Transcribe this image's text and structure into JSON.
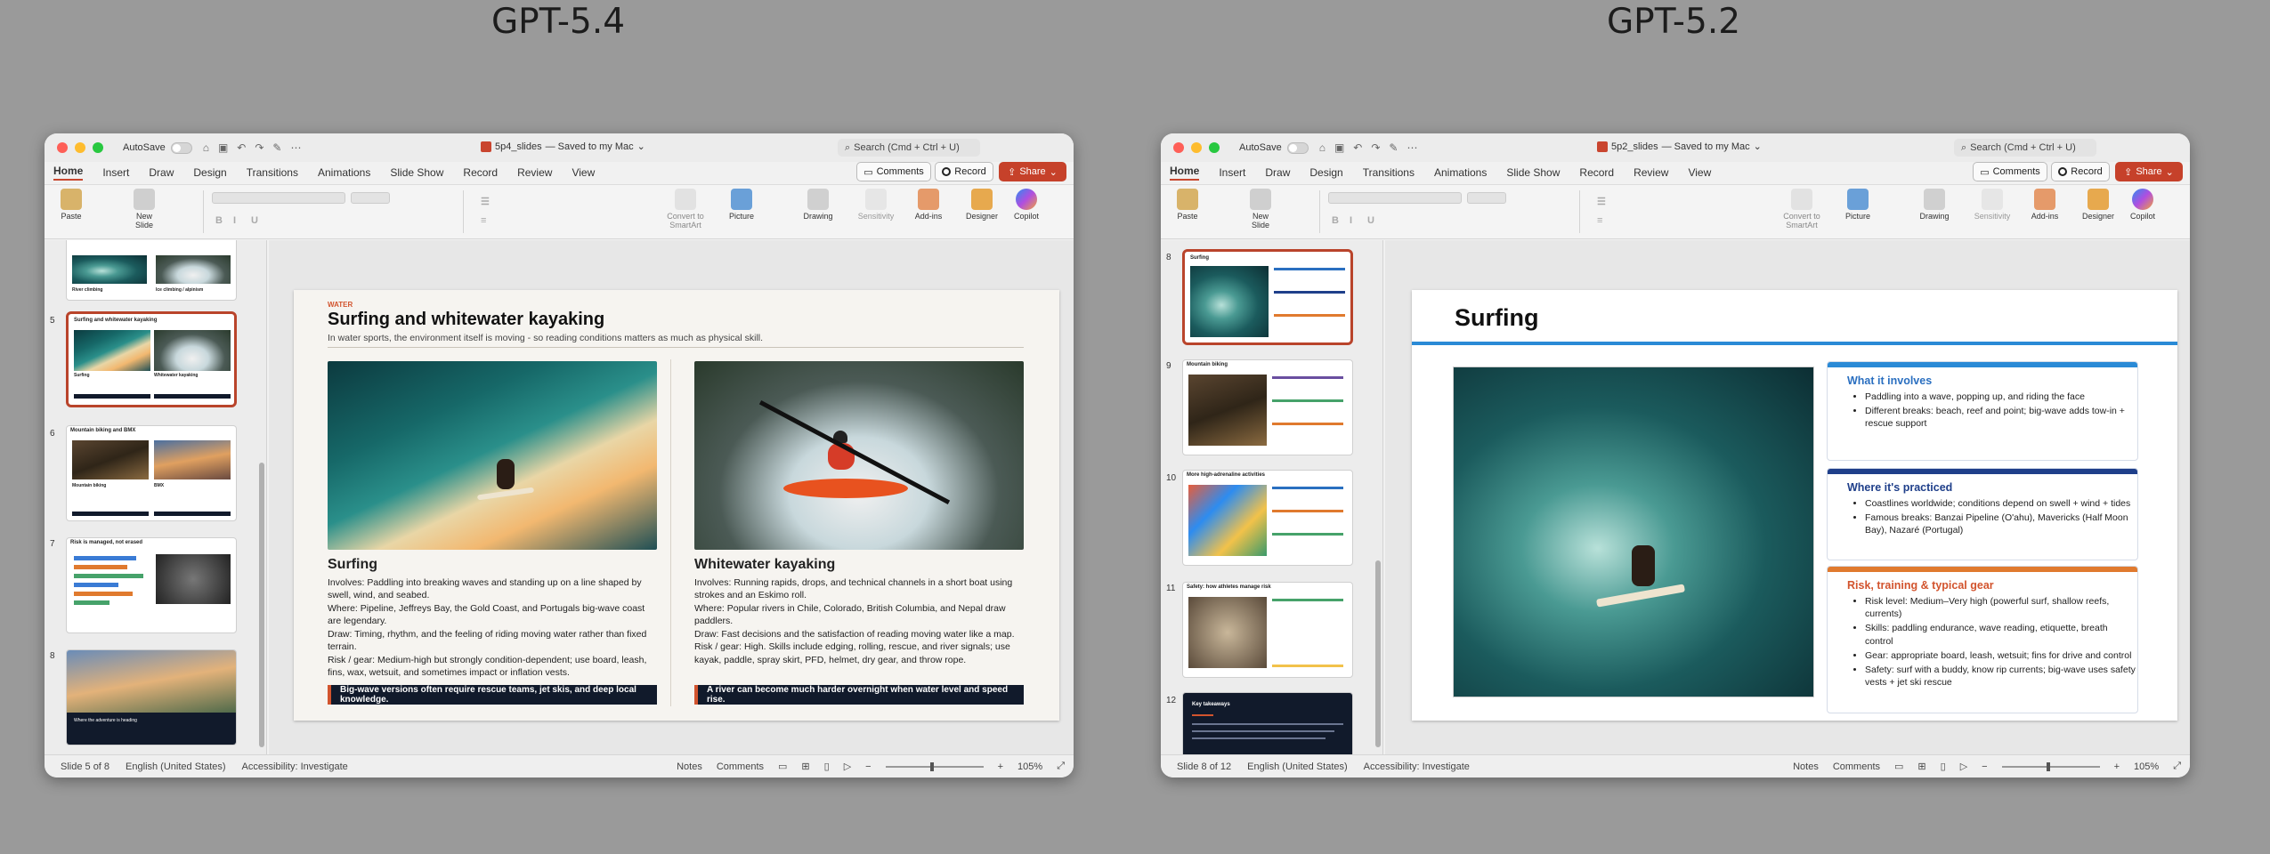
{
  "headings": {
    "left": "GPT-5.4",
    "right": "GPT-5.2"
  },
  "left_window": {
    "autosave_label": "AutoSave",
    "filename": "5p4_slides",
    "saved_status": "— Saved to my Mac",
    "search_placeholder": "Search (Cmd + Ctrl + U)",
    "menu": [
      "Home",
      "Insert",
      "Draw",
      "Design",
      "Transitions",
      "Animations",
      "Slide Show",
      "Record",
      "Review",
      "View"
    ],
    "comments_label": "Comments",
    "record_label": "Record",
    "share_label": "Share",
    "ribbon": {
      "paste": "Paste",
      "new_slide": "New Slide",
      "convert": "Convert to SmartArt",
      "picture": "Picture",
      "drawing": "Drawing",
      "sensitivity": "Sensitivity",
      "addins": "Add-ins",
      "designer": "Designer",
      "copilot": "Copilot"
    },
    "thumb_numbers": [
      "5",
      "6",
      "7",
      "8"
    ],
    "thumb_titles": {
      "t4a": "River climbing",
      "t4b": "Ice climbing / alpinism",
      "t5": "Surfing and whitewater kayaking",
      "t5a": "Surfing",
      "t5b": "Whitewater kayaking",
      "t6": "Mountain biking and BMX",
      "t6a": "Mountain biking",
      "t6b": "BMX",
      "t7": "Risk is managed, not erased",
      "t8": "Where the adventure is heading"
    },
    "slide": {
      "kicker": "WATER",
      "title": "Surfing and whitewater kayaking",
      "subtitle": "In water sports, the environment itself is moving - so reading conditions matters as much as physical skill.",
      "left_heading": "Surfing",
      "left_body": "Involves: Paddling into breaking waves and standing up on a line shaped by swell, wind, and seabed.\nWhere: Pipeline, Jeffreys Bay, the Gold Coast, and Portugals big-wave coast are legendary.\nDraw: Timing, rhythm, and the feeling of riding moving water rather than fixed terrain.\nRisk / gear: Medium-high but strongly condition-dependent; use board, leash, fins, wax, wetsuit, and sometimes impact or inflation vests.",
      "left_caption": "Big-wave versions often require rescue teams, jet skis, and deep local knowledge.",
      "right_heading": "Whitewater kayaking",
      "right_body": "Involves: Running rapids, drops, and technical channels in a short boat using strokes and an Eskimo roll.\nWhere: Popular rivers in Chile, Colorado, British Columbia, and Nepal draw paddlers.\nDraw: Fast decisions and the satisfaction of reading moving water like a map.\nRisk / gear: High. Skills include edging, rolling, rescue, and river signals; use kayak, paddle, spray skirt, PFD, helmet, dry gear, and throw rope.",
      "right_caption": "A river can become much harder overnight when water level and speed rise."
    },
    "status": {
      "slide": "Slide 5 of 8",
      "language": "English (United States)",
      "accessibility": "Accessibility: Investigate",
      "notes": "Notes",
      "comments": "Comments",
      "zoom": "105%"
    }
  },
  "right_window": {
    "autosave_label": "AutoSave",
    "filename": "5p2_slides",
    "saved_status": "— Saved to my Mac",
    "search_placeholder": "Search (Cmd + Ctrl + U)",
    "menu": [
      "Home",
      "Insert",
      "Draw",
      "Design",
      "Transitions",
      "Animations",
      "Slide Show",
      "Record",
      "Review",
      "View"
    ],
    "comments_label": "Comments",
    "record_label": "Record",
    "share_label": "Share",
    "ribbon": {
      "paste": "Paste",
      "new_slide": "New Slide",
      "convert": "Convert to SmartArt",
      "picture": "Picture",
      "drawing": "Drawing",
      "sensitivity": "Sensitivity",
      "addins": "Add-ins",
      "designer": "Designer",
      "copilot": "Copilot"
    },
    "thumb_numbers": [
      "8",
      "9",
      "10",
      "11",
      "12"
    ],
    "thumb_titles": {
      "t8": "Surfing",
      "t9": "Mountain biking",
      "t10": "More high-adrenaline activities",
      "t11": "Safety: how athletes manage risk",
      "t12": "Key takeaways"
    },
    "slide": {
      "title": "Surfing",
      "card1_title": "What it involves",
      "card1_items": [
        "Paddling into a wave, popping up, and riding the face",
        "Different breaks: beach, reef and point; big-wave adds tow-in + rescue support"
      ],
      "card2_title": "Where it's practiced",
      "card2_items": [
        "Coastlines worldwide; conditions depend on swell + wind + tides",
        "Famous breaks: Banzai Pipeline (O'ahu), Mavericks (Half Moon Bay), Nazaré (Portugal)"
      ],
      "card3_title": "Risk, training & typical gear",
      "card3_items": [
        "Risk level: Medium–Very high (powerful surf, shallow reefs, currents)",
        "Skills: paddling endurance, wave reading, etiquette, breath control",
        "Gear: appropriate board, leash, wetsuit; fins for drive and control",
        "Safety: surf with a buddy, know rip currents; big-wave uses safety vests + jet ski rescue"
      ]
    },
    "status": {
      "slide": "Slide 8 of 12",
      "language": "English (United States)",
      "accessibility": "Accessibility: Investigate",
      "notes": "Notes",
      "comments": "Comments",
      "zoom": "105%"
    }
  },
  "colors": {
    "accent_red": "#c6412a",
    "kicker_orange": "#d2542e",
    "blue": "#2a6fc0",
    "navy": "#1f3f8a",
    "orange": "#e07a2e"
  }
}
